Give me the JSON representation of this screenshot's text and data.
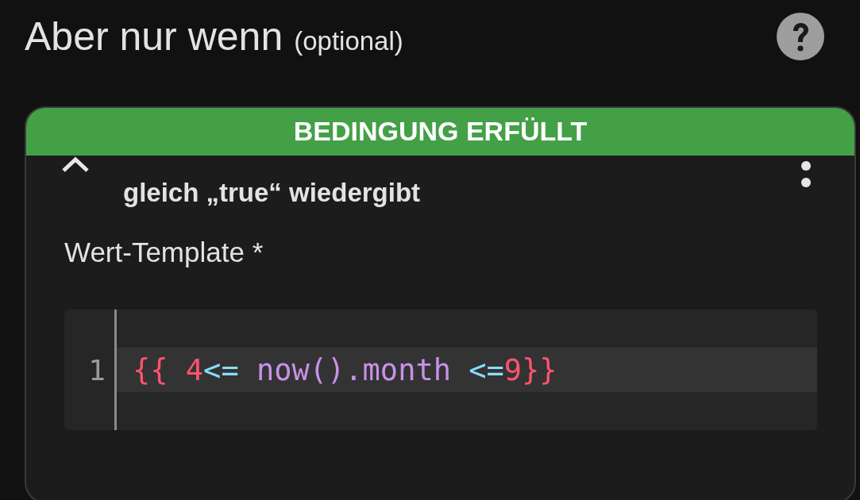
{
  "heading": {
    "title": "Aber nur wenn",
    "suffix": "(optional)"
  },
  "condition": {
    "banner": "BEDINGUNG ERFÜLLT",
    "expanded": true,
    "summary": "gleich „true“ wiedergibt",
    "field_label": "Wert-Template *",
    "editor": {
      "lines": [
        {
          "number": "1",
          "active": true,
          "tokens": [
            {
              "kind": "brace",
              "text": "{{ "
            },
            {
              "kind": "number",
              "text": "4"
            },
            {
              "kind": "operator",
              "text": "<= "
            },
            {
              "kind": "function",
              "text": "now().month "
            },
            {
              "kind": "operator",
              "text": "<="
            },
            {
              "kind": "number",
              "text": "9"
            },
            {
              "kind": "brace",
              "text": "}}"
            }
          ]
        }
      ]
    }
  }
}
